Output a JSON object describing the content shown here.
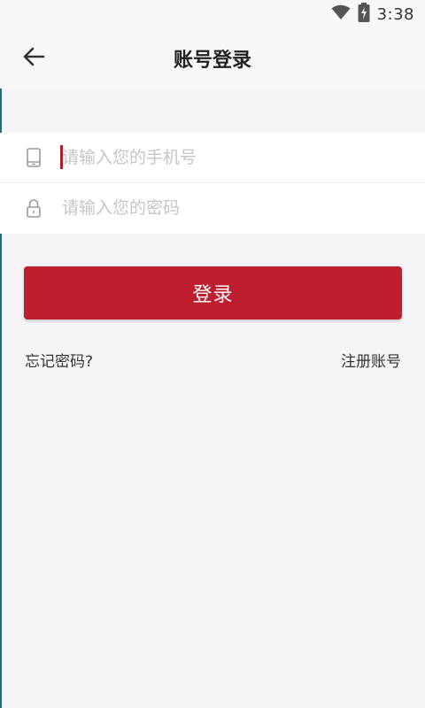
{
  "status_bar": {
    "time": "3:38",
    "icons": [
      "wifi-icon",
      "battery-charging-icon"
    ]
  },
  "header": {
    "back_icon": "arrow-left-icon",
    "title": "账号登录"
  },
  "form": {
    "phone": {
      "icon": "phone-icon",
      "placeholder": "请输入您的手机号",
      "value": ""
    },
    "password": {
      "icon": "lock-icon",
      "placeholder": "请输入您的密码",
      "value": ""
    }
  },
  "actions": {
    "login_label": "登录",
    "forgot_password_label": "忘记密码?",
    "register_label": "注册账号"
  },
  "colors": {
    "accent": "#bf1e2e",
    "background": "#f5f4f7"
  }
}
